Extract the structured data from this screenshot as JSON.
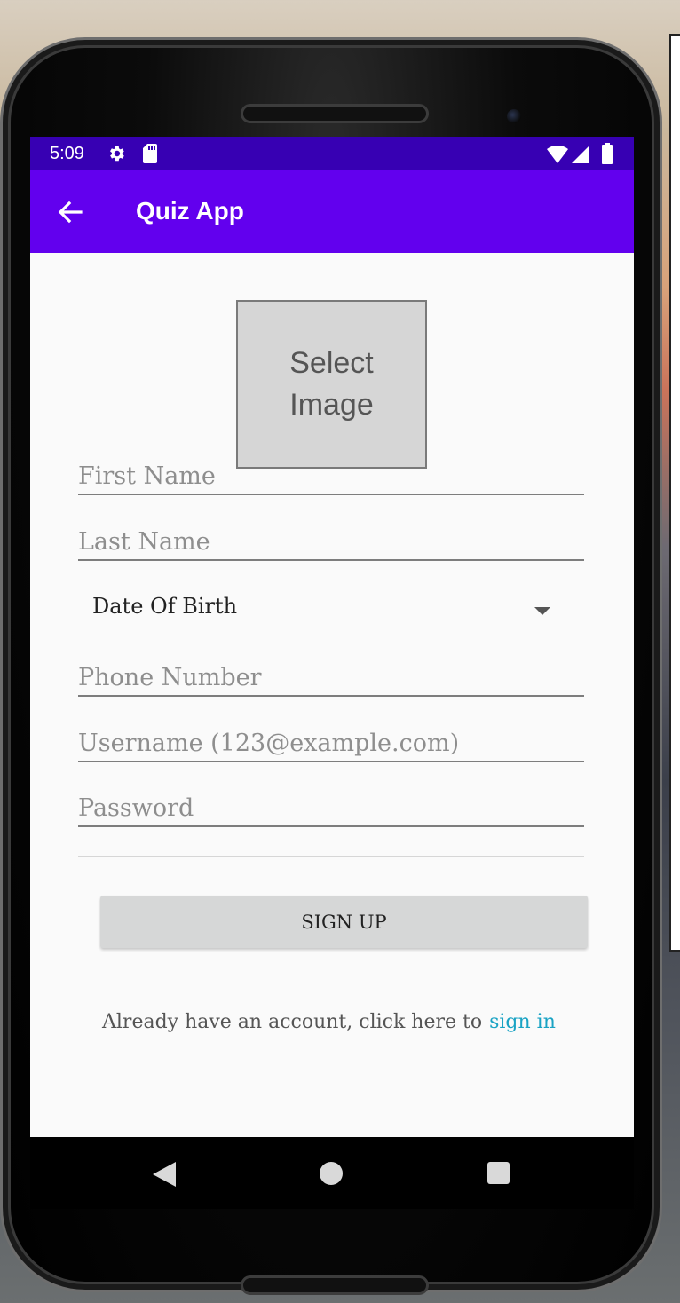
{
  "status_bar": {
    "time": "5:09",
    "icons": [
      "gear-icon",
      "sd-card-icon",
      "wifi-icon",
      "signal-icon",
      "battery-icon"
    ]
  },
  "app_bar": {
    "title": "Quiz App",
    "back_icon": "arrow-left-icon"
  },
  "form": {
    "select_image_label": "Select\nImage",
    "first_name_placeholder": "First Name",
    "last_name_placeholder": "Last Name",
    "date_of_birth_label": "Date Of Birth",
    "phone_placeholder": "Phone Number",
    "username_placeholder": "Username (123@example.com)",
    "password_placeholder": "Password",
    "signup_button": "SIGN UP",
    "signin_prompt": "Already have an account, click here to",
    "signin_link": "sign in"
  },
  "nav_bar": {
    "icons": [
      "nav-back-icon",
      "nav-home-icon",
      "nav-recents-icon"
    ]
  },
  "colors": {
    "status_bar": "#3700b3",
    "app_bar": "#6200ee",
    "link": "#1aa3c4",
    "button_bg": "#d6d7d7"
  }
}
